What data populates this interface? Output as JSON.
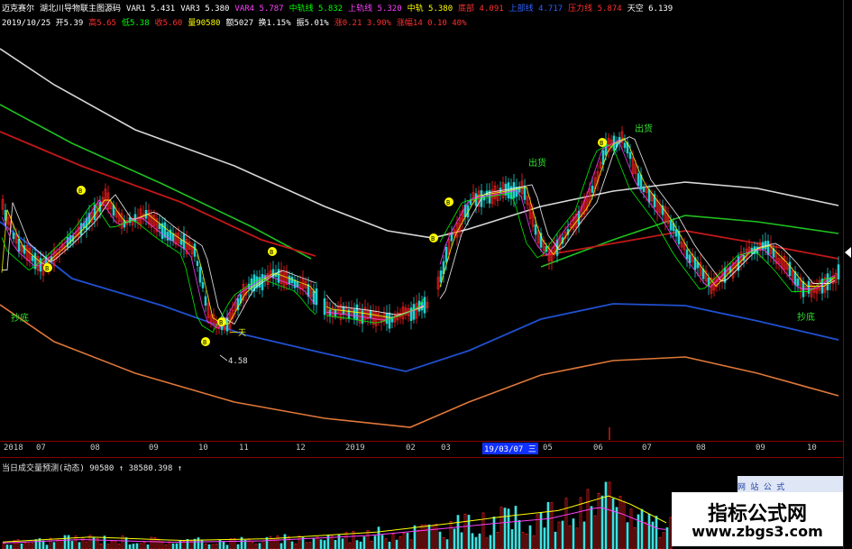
{
  "infobar": {
    "row1": [
      {
        "text": "迈克赛尔",
        "color": "#ffffff"
      },
      {
        "text": "湖北川导物联主图源码",
        "color": "#ffffff"
      },
      {
        "text": "VAR1 5.431",
        "color": "#ffffff"
      },
      {
        "text": "VAR3 5.380",
        "color": "#ffffff"
      },
      {
        "text": "VAR4 5.787",
        "color": "#ff40ff"
      },
      {
        "text": "中轨线 5.832",
        "color": "#00ff00"
      },
      {
        "text": "上轨线 5.320",
        "color": "#ff40ff"
      },
      {
        "text": "中轨 5.380",
        "color": "#ffff00"
      },
      {
        "text": "底部 4.091",
        "color": "#ff3030"
      },
      {
        "text": "上部线 4.717",
        "color": "#3060ff"
      },
      {
        "text": "压力线 5.874",
        "color": "#ff3030"
      },
      {
        "text": "天空 6.139",
        "color": "#ffffff"
      }
    ],
    "row2": [
      {
        "text": "2019/10/25 开5.39",
        "color": "#ffffff"
      },
      {
        "text": "高5.65",
        "color": "#ff3030"
      },
      {
        "text": "低5.38",
        "color": "#00ff00"
      },
      {
        "text": "收5.60",
        "color": "#ff3030"
      },
      {
        "text": "量90580",
        "color": "#ffff00"
      },
      {
        "text": "额5027 换1.15%",
        "color": "#ffffff"
      },
      {
        "text": "振5.01%",
        "color": "#ffffff"
      },
      {
        "text": "涨0.21 3.90%",
        "color": "#ff3030"
      },
      {
        "text": "涨幅14 0.10 40%",
        "color": "#ff3030"
      }
    ]
  },
  "annotations": {
    "chaodi_left": "抄底",
    "chaodi_right": "抄底",
    "chuchao": "出货",
    "chuhuo_top": "出货",
    "low_price": "4.58",
    "tian": "一天",
    "marker_letter": "B"
  },
  "axis": {
    "ticks": [
      "2018",
      "07",
      "08",
      "09",
      "10",
      "11",
      "12",
      "2019",
      "02",
      "03",
      "04",
      "05",
      "06",
      "07",
      "08",
      "09",
      "10"
    ],
    "selected_date": "19/03/07 三"
  },
  "volume": {
    "header": "当日成交量预测(动态) 90580 ↑ 38580.398 ↑"
  },
  "watermark": {
    "title": "指标公式网",
    "url": "www.zbgs3.com",
    "corner_text": "网 站 公 式"
  },
  "colors": {
    "background": "#000000",
    "axis_border": "#8a0000",
    "white_band": "#d8d8d8",
    "green_band": "#20c020",
    "red_band": "#c01818",
    "blue_band": "#2050d0",
    "orange_band": "#e07838",
    "candle_up": "#ff2020",
    "candle_down": "#20d0d0",
    "signal_yellow": "#ffff00"
  }
}
